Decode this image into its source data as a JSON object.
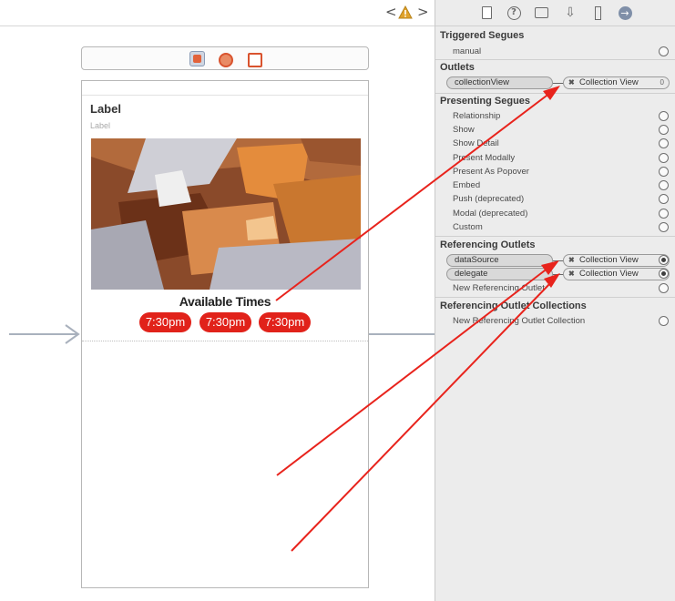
{
  "canvas": {
    "nav_back": "<",
    "nav_forward": ">",
    "warning": "!"
  },
  "cell": {
    "title": "Label",
    "subtitle": "Label",
    "available_label": "Available Times",
    "times": [
      "7:30pm",
      "7:30pm",
      "7:30pm"
    ],
    "time_button_color": "#e1221a"
  },
  "inspector": {
    "toolbar_icons": [
      "file-icon",
      "help-icon",
      "identity-icon",
      "attributes-icon",
      "size-icon",
      "connections-icon"
    ],
    "triggered_segues": {
      "title": "Triggered Segues",
      "items": [
        "manual"
      ]
    },
    "outlets": {
      "title": "Outlets",
      "items": [
        {
          "name": "collectionView",
          "target": "Collection View",
          "target_badge": "0"
        }
      ]
    },
    "presenting_segues": {
      "title": "Presenting Segues",
      "items": [
        "Relationship",
        "Show",
        "Show Detail",
        "Present Modally",
        "Present As Popover",
        "Embed",
        "Push (deprecated)",
        "Modal (deprecated)",
        "Custom"
      ]
    },
    "referencing_outlets": {
      "title": "Referencing Outlets",
      "items": [
        {
          "name": "dataSource",
          "target": "Collection View"
        },
        {
          "name": "delegate",
          "target": "Collection View"
        }
      ],
      "new_label": "New Referencing Outlet"
    },
    "referencing_outlet_collections": {
      "title": "Referencing Outlet Collections",
      "new_label": "New Referencing Outlet Collection"
    }
  },
  "colors": {
    "arrow": "#e8231c",
    "accent": "#e1221a"
  }
}
